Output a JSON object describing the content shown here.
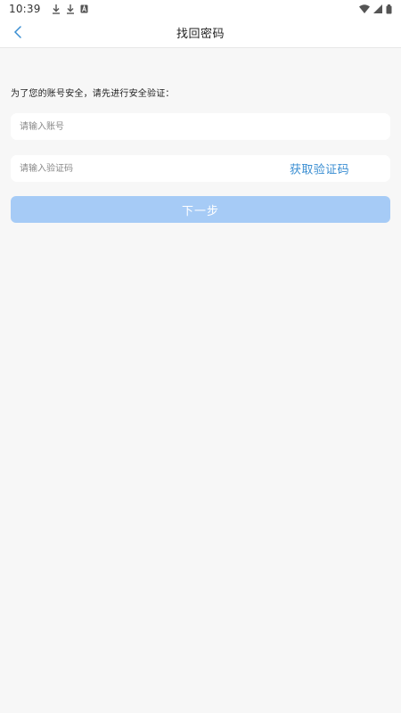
{
  "status_bar": {
    "time": "10:39",
    "left_icons": [
      "download-icon",
      "download-icon",
      "a-box-icon"
    ],
    "right_icons": [
      "wifi-icon",
      "signal-icon",
      "battery-icon"
    ]
  },
  "nav": {
    "title": "找回密码",
    "back_icon": "chevron-left-icon"
  },
  "form": {
    "hint": "为了您的账号安全，请先进行安全验证：",
    "account_placeholder": "请输入账号",
    "account_value": "",
    "code_placeholder": "请输入验证码",
    "code_value": "",
    "get_code_label": "获取验证码",
    "next_label": "下一步"
  },
  "colors": {
    "accent": "#3a8ed2",
    "button_disabled": "#a6cbf6",
    "background": "#f7f7f7"
  }
}
